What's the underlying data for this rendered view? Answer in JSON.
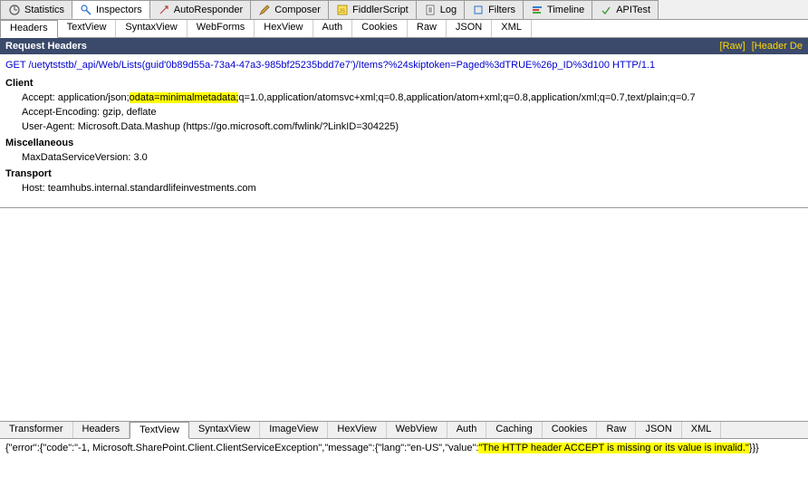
{
  "top_tabs": {
    "statistics": "Statistics",
    "inspectors": "Inspectors",
    "autoresponder": "AutoResponder",
    "composer": "Composer",
    "fiddlerscript": "FiddlerScript",
    "log": "Log",
    "filters": "Filters",
    "timeline": "Timeline",
    "apitest": "APITest"
  },
  "req_sub_tabs": {
    "headers": "Headers",
    "textview": "TextView",
    "syntaxview": "SyntaxView",
    "webforms": "WebForms",
    "hexview": "HexView",
    "auth": "Auth",
    "cookies": "Cookies",
    "raw": "Raw",
    "json": "JSON",
    "xml": "XML"
  },
  "header_bar": {
    "title": "Request Headers",
    "raw_link": "[Raw]",
    "defs_link": "[Header De"
  },
  "request": {
    "line": "GET /uetytststb/_api/Web/Lists(guid'0b89d55a-73a4-47a3-985bf25235bdd7e7')/Items?%24skiptoken=Paged%3dTRUE%26p_ID%3d100 HTTP/1.1",
    "sections": {
      "client": {
        "title": "Client",
        "accept_prefix": "Accept: application/json;",
        "accept_hl": "odata=minimalmetadata;",
        "accept_suffix": "q=1.0,application/atomsvc+xml;q=0.8,application/atom+xml;q=0.8,application/xml;q=0.7,text/plain;q=0.7",
        "accept_encoding": "Accept-Encoding: gzip, deflate",
        "user_agent": "User-Agent: Microsoft.Data.Mashup (https://go.microsoft.com/fwlink/?LinkID=304225)"
      },
      "misc": {
        "title": "Miscellaneous",
        "maxdata": "MaxDataServiceVersion: 3.0"
      },
      "transport": {
        "title": "Transport",
        "host": "Host: teamhubs.internal.standardlifeinvestments.com"
      }
    }
  },
  "resp_sub_tabs": {
    "transformer": "Transformer",
    "headers": "Headers",
    "textview": "TextView",
    "syntaxview": "SyntaxView",
    "imageview": "ImageView",
    "hexview": "HexView",
    "webview": "WebView",
    "auth": "Auth",
    "caching": "Caching",
    "cookies": "Cookies",
    "raw": "Raw",
    "json": "JSON",
    "xml": "XML"
  },
  "response": {
    "prefix": "{\"error\":{\"code\":\"-1, Microsoft.SharePoint.Client.ClientServiceException\",\"message\":{\"lang\":\"en-US\",\"value\":",
    "hl": "\"The HTTP header ACCEPT is missing or its value is invalid.\"",
    "suffix": "}}}"
  }
}
